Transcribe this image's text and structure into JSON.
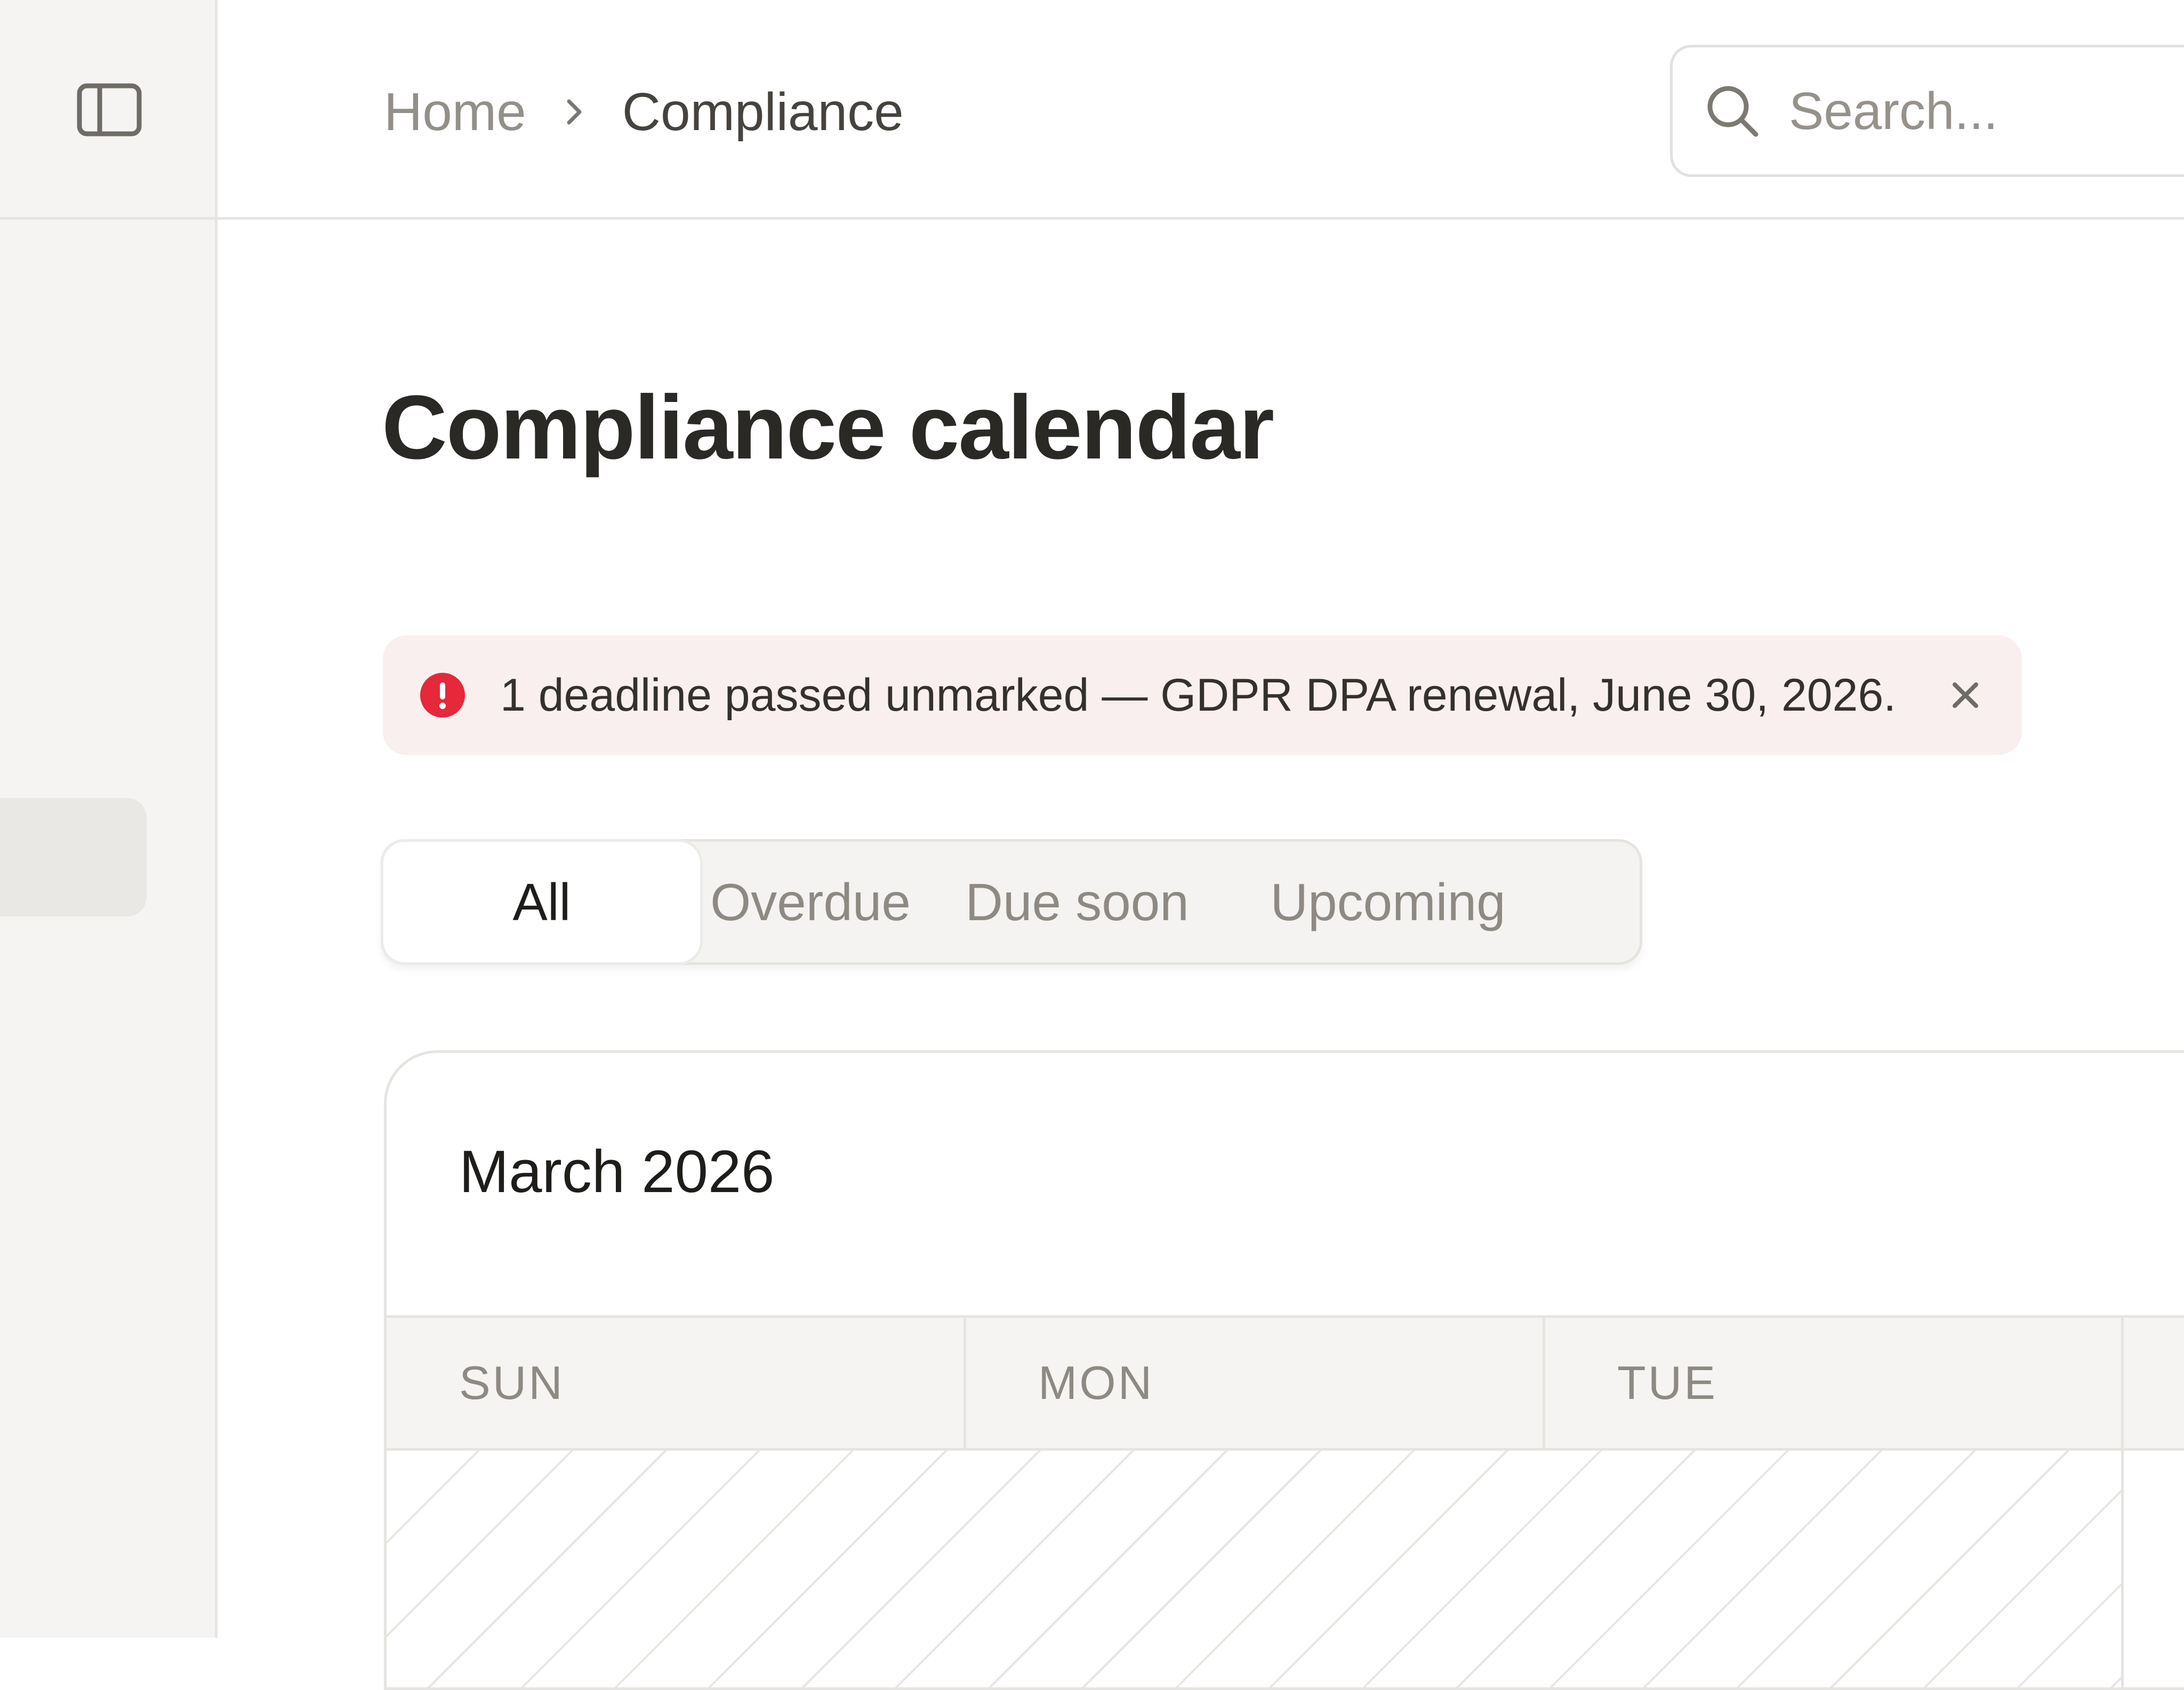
{
  "sidebar": {
    "toggle_icon": "sidebar-toggle-icon"
  },
  "header": {
    "breadcrumb": {
      "home": "Home",
      "current": "Compliance"
    },
    "search": {
      "placeholder": "Search..."
    }
  },
  "main": {
    "title": "Compliance calendar",
    "alert": {
      "message": "1 deadline passed unmarked — GDPR DPA renewal, June 30, 2026.",
      "icon": "alert-circle-icon",
      "color": "#e5283a"
    },
    "tabs": [
      {
        "label": "All",
        "active": true
      },
      {
        "label": "Overdue",
        "active": false
      },
      {
        "label": "Due soon",
        "active": false
      },
      {
        "label": "Upcoming",
        "active": false
      }
    ],
    "calendar": {
      "month": "March 2026",
      "weekdays": [
        "SUN",
        "MON",
        "TUE"
      ]
    }
  },
  "colors": {
    "sidebar_bg": "#f5f4f2",
    "border": "#e7e5e1",
    "text_primary": "#2b2926",
    "text_muted": "#8e8a83",
    "alert_bg": "#f9efef",
    "alert_accent": "#e5283a"
  }
}
